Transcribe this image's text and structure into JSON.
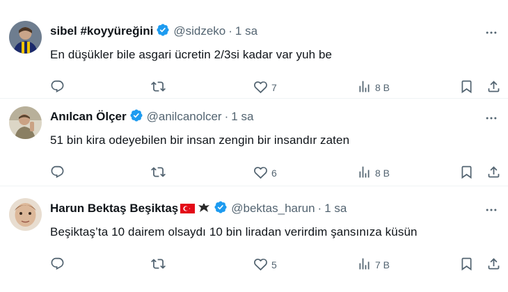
{
  "tweets": [
    {
      "name": "sibel #koyyüreğini",
      "handle": "@sidzeko",
      "dot": "·",
      "time": "1 sa",
      "text": "En düşükler bile asgari ücretin 2/3si kadar var yuh be",
      "reply_count": "",
      "retweet_count": "",
      "like_count": "7",
      "view_count": "8 B",
      "avatar_colors": [
        "#1b2a6b",
        "#f2c400"
      ]
    },
    {
      "name": "Anılcan Ölçer",
      "handle": "@anilcanolcer",
      "dot": "·",
      "time": "1 sa",
      "text": "51 bin kira odeyebilen bir insan zengin bir insandır zaten",
      "reply_count": "",
      "retweet_count": "",
      "like_count": "6",
      "view_count": "8 B",
      "avatar_colors": [
        "#cfc8b4",
        "#8a7f63"
      ]
    },
    {
      "name": "Harun Bektaş Beşiktaş",
      "handle": "@bektas_harun",
      "dot": "·",
      "time": "1 sa",
      "text": "Beşiktaş’ta 10 dairem olsaydı 10 bin liradan verirdim şansınıza küsün",
      "reply_count": "",
      "retweet_count": "",
      "like_count": "5",
      "view_count": "7 B",
      "avatar_colors": [
        "#d9b89c",
        "#8a5a3a"
      ]
    }
  ],
  "colors": {
    "text": "#0f1419",
    "secondary": "#536471",
    "verified": "#1d9bf0",
    "divider": "#eff3f4",
    "flag_red": "#e30a17"
  },
  "icons": [
    "reply-icon",
    "retweet-icon",
    "like-icon",
    "views-icon",
    "bookmark-icon",
    "share-icon",
    "more-icon",
    "verified-icon"
  ]
}
